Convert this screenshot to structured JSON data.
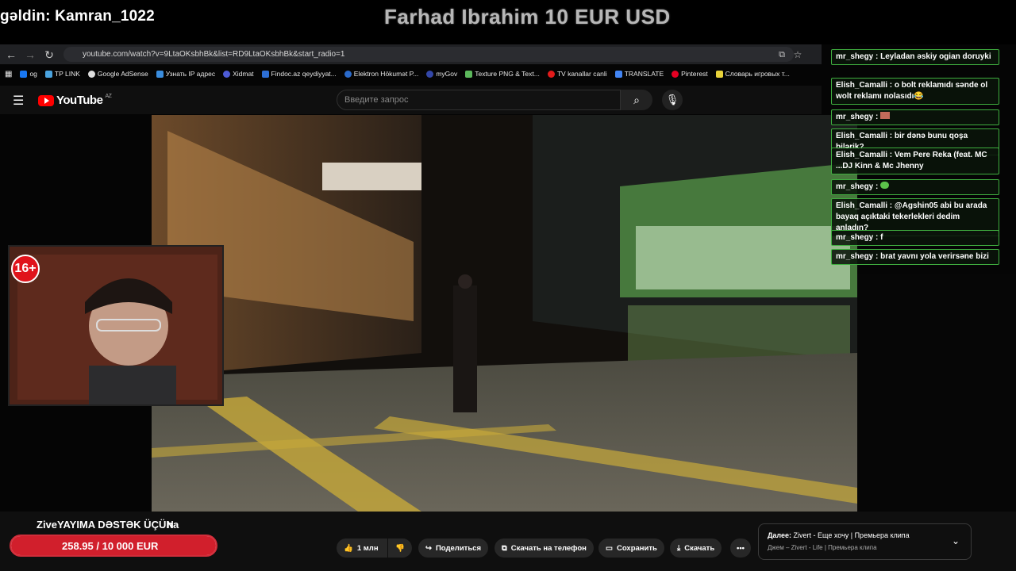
{
  "overlay": {
    "welcome": "gəldin: Kamran_1022",
    "stream_title": "Farhad Ibrahim 10 EUR USD"
  },
  "browser": {
    "url": "youtube.com/watch?v=9LtaOKsbhBk&list=RD9LtaOKsbhBk&start_radio=1",
    "bookmarks": [
      "og",
      "TP LINK",
      "Google AdSense",
      "Узнать IP адрес",
      "Xidmat",
      "Findoc.az qeydiyyat...",
      "Elektron Hökumət P...",
      "myGov",
      "Texture PNG & Text...",
      "TV kanallar canli",
      "TRANSLATE",
      "Pinterest",
      "Словарь игровых т..."
    ]
  },
  "youtube": {
    "logo_text": "YouTube",
    "country": "AZ",
    "search_placeholder": "Введите запрос"
  },
  "camera": {
    "age_badge": "16+"
  },
  "chat": {
    "messages": [
      {
        "user": "mr_shegy",
        "text": "Leyladan əskiy ogian doruyki"
      },
      {
        "user": "Elish_Camalli",
        "text": "o bolt reklamıdı sənde ol wolt reklamı nolasıdı😂"
      },
      {
        "user": "mr_shegy",
        "text": ""
      },
      {
        "user": "Elish_Camalli",
        "text": "bir dənə bunu qoşa bilərik?"
      },
      {
        "user": "Elish_Camalli",
        "text": "Vem Pere Reka (feat. MC ...DJ Kinn & Mc Jhenny"
      },
      {
        "user": "mr_shegy",
        "text": ""
      },
      {
        "user": "Elish_Camalli",
        "text": "@Agshin05 abi bu arada bayaq açıktaki tekerlekleri dedim anladın?"
      },
      {
        "user": "mr_shegy",
        "text": "f"
      },
      {
        "user": "mr_shegy",
        "text": "brat yavnı yola verirsəne bizi"
      }
    ]
  },
  "video_info": {
    "title_partial": "Zive",
    "title_end": "na",
    "support_title": "YAYIMA DƏSTƏK ÜÇÜN"
  },
  "donation": {
    "text": "258.95 / 10 000 EUR",
    "progress": 0.026
  },
  "actions": {
    "likes": "1 млн",
    "share": "Поделиться",
    "phone": "Скачать на телефон",
    "save": "Сохранить",
    "download": "Скачать"
  },
  "next_up": {
    "label_prefix": "Далее:",
    "label": "Zivert - Еще хочу | Премьера клипа",
    "sub": "Джем – Zivert - Life | Премьера клипа"
  },
  "colors": {
    "chat_border": "#3fae3f",
    "donation_bar": "#d11f2c",
    "youtube_red": "#ff0000"
  }
}
